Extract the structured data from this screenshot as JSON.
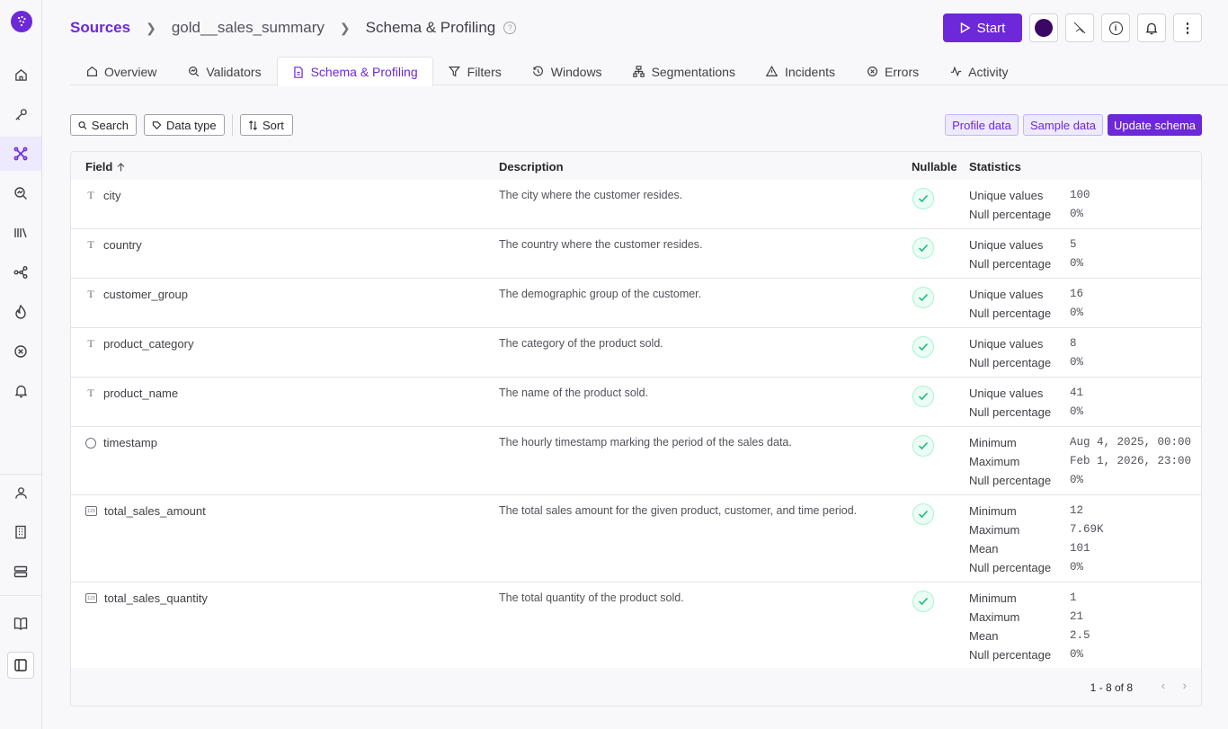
{
  "breadcrumb": {
    "root": "Sources",
    "source": "gold__sales_summary",
    "current": "Schema & Profiling",
    "help": "?"
  },
  "header": {
    "start_label": "Start",
    "info_glyph": "i",
    "menu_glyph": "⋮"
  },
  "tabs": [
    {
      "label": "Overview",
      "icon": "home-icon"
    },
    {
      "label": "Validators",
      "icon": "validator-icon"
    },
    {
      "label": "Schema & Profiling",
      "icon": "document-icon"
    },
    {
      "label": "Filters",
      "icon": "filter-icon"
    },
    {
      "label": "Windows",
      "icon": "clock-icon"
    },
    {
      "label": "Segmentations",
      "icon": "hierarchy-icon"
    },
    {
      "label": "Incidents",
      "icon": "warning-icon"
    },
    {
      "label": "Errors",
      "icon": "error-icon"
    },
    {
      "label": "Activity",
      "icon": "activity-icon"
    }
  ],
  "toolbar": {
    "search_label": "Search",
    "datatype_label": "Data type",
    "sort_label": "Sort",
    "profile_label": "Profile data",
    "sample_label": "Sample data",
    "update_label": "Update schema"
  },
  "table": {
    "headers": {
      "field": "Field",
      "description": "Description",
      "nullable": "Nullable",
      "statistics": "Statistics"
    },
    "rows": [
      {
        "type": "string",
        "type_glyph": "T",
        "field": "city",
        "description": "The city where the customer resides.",
        "stats": [
          {
            "label": "Unique values",
            "value": "100"
          },
          {
            "label": "Null percentage",
            "value": "0%"
          }
        ]
      },
      {
        "type": "string",
        "type_glyph": "T",
        "field": "country",
        "description": "The country where the customer resides.",
        "stats": [
          {
            "label": "Unique values",
            "value": "5"
          },
          {
            "label": "Null percentage",
            "value": "0%"
          }
        ]
      },
      {
        "type": "string",
        "type_glyph": "T",
        "field": "customer_group",
        "description": "The demographic group of the customer.",
        "stats": [
          {
            "label": "Unique values",
            "value": "16"
          },
          {
            "label": "Null percentage",
            "value": "0%"
          }
        ]
      },
      {
        "type": "string",
        "type_glyph": "T",
        "field": "product_category",
        "description": "The category of the product sold.",
        "stats": [
          {
            "label": "Unique values",
            "value": "8"
          },
          {
            "label": "Null percentage",
            "value": "0%"
          }
        ]
      },
      {
        "type": "string",
        "type_glyph": "T",
        "field": "product_name",
        "description": "The name of the product sold.",
        "stats": [
          {
            "label": "Unique values",
            "value": "41"
          },
          {
            "label": "Null percentage",
            "value": "0%"
          }
        ]
      },
      {
        "type": "timestamp",
        "type_glyph": "",
        "field": "timestamp",
        "description": "The hourly timestamp marking the period of the sales data.",
        "stats": [
          {
            "label": "Minimum",
            "value": "Aug 4, 2025, 00:00"
          },
          {
            "label": "Maximum",
            "value": "Feb 1, 2026, 23:00"
          },
          {
            "label": "Null percentage",
            "value": "0%"
          }
        ]
      },
      {
        "type": "number",
        "type_glyph": "123",
        "field": "total_sales_amount",
        "description": "The total sales amount for the given product, customer, and time period.",
        "stats": [
          {
            "label": "Minimum",
            "value": "12"
          },
          {
            "label": "Maximum",
            "value": "7.69K"
          },
          {
            "label": "Mean",
            "value": "101"
          },
          {
            "label": "Null percentage",
            "value": "0%"
          }
        ]
      },
      {
        "type": "number",
        "type_glyph": "123",
        "field": "total_sales_quantity",
        "description": "The total quantity of the product sold.",
        "stats": [
          {
            "label": "Minimum",
            "value": "1"
          },
          {
            "label": "Maximum",
            "value": "21"
          },
          {
            "label": "Mean",
            "value": "2.5"
          },
          {
            "label": "Null percentage",
            "value": "0%"
          }
        ]
      }
    ],
    "pagination": "1 - 8 of 8"
  },
  "colors": {
    "accent": "#6d28d9",
    "success": "#10b981",
    "border": "#e4e4e7"
  }
}
